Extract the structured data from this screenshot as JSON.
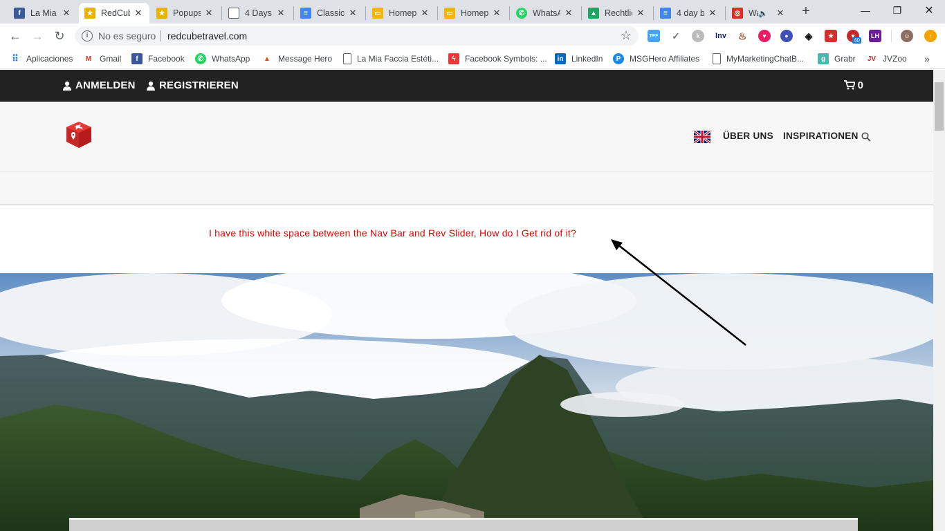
{
  "browser": {
    "tabs": [
      {
        "title": "La Mia",
        "icon": "facebook-icon",
        "color": "#3b5998"
      },
      {
        "title": "RedCub",
        "icon": "redcube-icon",
        "color": "#c0392b"
      },
      {
        "title": "Popups",
        "icon": "redcube-icon",
        "color": "#c0392b"
      },
      {
        "title": "4 Days",
        "icon": "document-icon",
        "color": "#5f6368"
      },
      {
        "title": "Classic",
        "icon": "google-docs-icon",
        "color": "#4285f4"
      },
      {
        "title": "Homep",
        "icon": "google-slides-icon",
        "color": "#f4b400"
      },
      {
        "title": "Homep",
        "icon": "google-slides-icon",
        "color": "#f4b400"
      },
      {
        "title": "WhatsA",
        "icon": "whatsapp-icon",
        "color": "#25d366"
      },
      {
        "title": "Rechtlic",
        "icon": "google-drive-icon",
        "color": "#1fa463"
      },
      {
        "title": "4 day b",
        "icon": "google-docs-icon",
        "color": "#4285f4"
      },
      {
        "title": "Wa",
        "icon": "web-icon",
        "color": "#d93025"
      }
    ],
    "security_label": "No es seguro",
    "url": "redcubetravel.com",
    "bookmarks": [
      {
        "label": "Aplicaciones",
        "icon": "apps-grid-icon"
      },
      {
        "label": "Gmail",
        "icon": "gmail-icon"
      },
      {
        "label": "Facebook",
        "icon": "facebook-icon"
      },
      {
        "label": "WhatsApp",
        "icon": "whatsapp-icon"
      },
      {
        "label": "Message Hero",
        "icon": "message-hero-icon"
      },
      {
        "label": "La Mia Faccia Estéti...",
        "icon": "document-icon"
      },
      {
        "label": "Facebook Symbols: ...",
        "icon": "facebook-symbols-icon"
      },
      {
        "label": "LinkedIn",
        "icon": "linkedin-icon"
      },
      {
        "label": "MSGHero Affiliates",
        "icon": "msghero-icon"
      },
      {
        "label": "MyMarketingChatB...",
        "icon": "document-icon"
      },
      {
        "label": "Grabr",
        "icon": "grabr-icon"
      },
      {
        "label": "JVZoo",
        "icon": "jvzoo-icon"
      }
    ],
    "extensions": {
      "inv_label": "Inv",
      "lh_label": "LH",
      "badge_count": "40"
    }
  },
  "site": {
    "topbar": {
      "login_label": "ANMELDEN",
      "register_label": "REGISTRIEREN",
      "cart_count": "0"
    },
    "nav": {
      "about_label": "ÜBER UNS",
      "inspirations_label": "INSPIRATIONEN"
    },
    "annotation": "I have this white space between the Nav Bar and Rev Slider, How do I Get rid of it?"
  }
}
